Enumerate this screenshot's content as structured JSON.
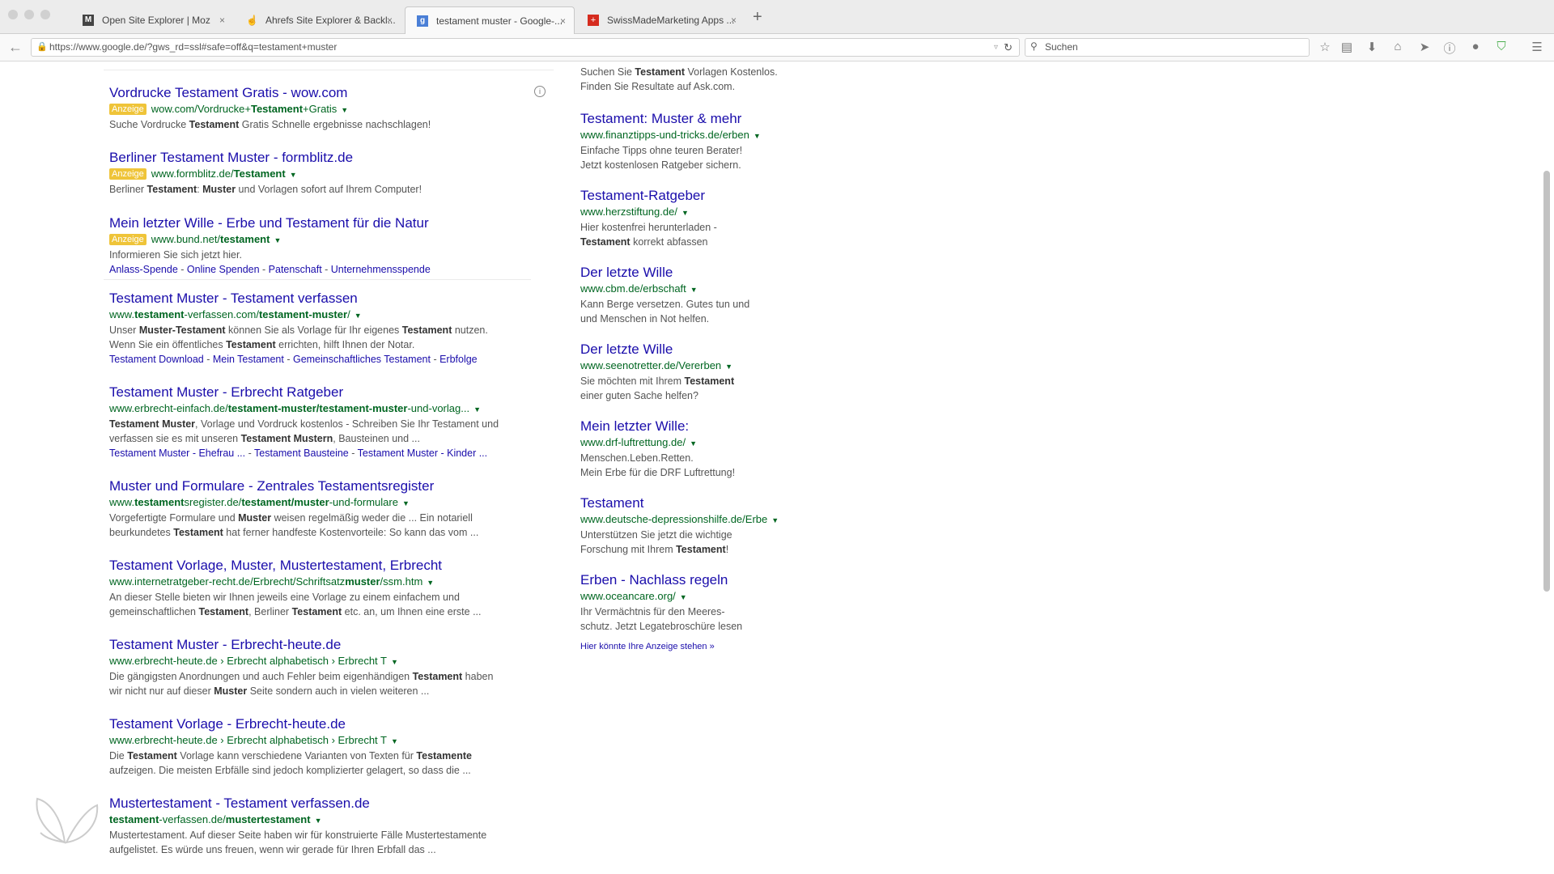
{
  "browser": {
    "tabs": [
      {
        "label": "Open Site Explorer | Moz",
        "icon": "moz-icon",
        "active": false
      },
      {
        "label": "Ahrefs Site Explorer & Backl...",
        "icon": "ahrefs-icon",
        "active": false
      },
      {
        "label": "testament muster - Google-...",
        "icon": "google-icon",
        "active": true
      },
      {
        "label": "SwissMadeMarketing Apps ...",
        "icon": "swiss-icon",
        "active": false
      }
    ],
    "new_tab": "+",
    "close": "×",
    "url": "https://www.google.de/?gws_rd=ssl#safe=off&q=testament+muster",
    "search_placeholder": "Suchen",
    "toolbar_icons": [
      "star-icon",
      "clipboard-icon",
      "download-icon",
      "home-icon",
      "send-icon",
      "info-icon",
      "chat-icon",
      "shield-icon",
      "menu-icon"
    ],
    "colors": {
      "accent": "#1a0dab",
      "url_green": "#006621",
      "ad_badge": "#efc439"
    }
  },
  "main": {
    "badge": "Anzeige",
    "ads": [
      {
        "title": "Vordrucke Testament Gratis - wow.com",
        "url_parts": [
          [
            "wow.com/Vordrucke+",
            false
          ],
          [
            "Testament",
            true
          ],
          [
            "+Gratis",
            false
          ]
        ],
        "snippet": [
          [
            "Suche Vordrucke ",
            false
          ],
          [
            "Testament",
            true
          ],
          [
            " Gratis Schnelle ergebnisse nachschlagen!",
            false
          ]
        ]
      },
      {
        "title": "Berliner Testament Muster - formblitz.de",
        "url_parts": [
          [
            "www.formblitz.de/",
            false
          ],
          [
            "Testament",
            true
          ]
        ],
        "snippet": [
          [
            "Berliner ",
            false
          ],
          [
            "Testament",
            true
          ],
          [
            ": ",
            false
          ],
          [
            "Muster",
            true
          ],
          [
            " und Vorlagen sofort auf Ihrem Computer!",
            false
          ]
        ]
      },
      {
        "title": "Mein letzter Wille - Erbe und Testament für die Natur",
        "url_parts": [
          [
            "www.bund.net/",
            false
          ],
          [
            "testament",
            true
          ]
        ],
        "snippet": [
          [
            "Informieren Sie sich jetzt hier.",
            false
          ]
        ],
        "sitelinks": [
          "Anlass-Spende",
          "Online Spenden",
          "Patenschaft",
          "Unternehmensspende"
        ]
      }
    ],
    "results": [
      {
        "title": "Testament Muster - Testament verfassen",
        "url_parts": [
          [
            "www.",
            false
          ],
          [
            "testament",
            true
          ],
          [
            "-verfassen.com/",
            false
          ],
          [
            "testament-muster",
            true
          ],
          [
            "/",
            false
          ]
        ],
        "lines": [
          [
            [
              "Unser ",
              false
            ],
            [
              "Muster-Testament",
              true
            ],
            [
              " können Sie als Vorlage für Ihr eigenes ",
              false
            ],
            [
              "Testament",
              true
            ],
            [
              " nutzen.",
              false
            ]
          ],
          [
            [
              "Wenn Sie ein öffentliches ",
              false
            ],
            [
              "Testament",
              true
            ],
            [
              " errichten, hilft Ihnen der Notar.",
              false
            ]
          ]
        ],
        "sitelinks": [
          "Testament Download",
          "Mein Testament",
          "Gemeinschaftliches Testament",
          "Erbfolge"
        ]
      },
      {
        "title": "Testament Muster - Erbrecht Ratgeber",
        "url_parts": [
          [
            "www.erbrecht-einfach.de/",
            false
          ],
          [
            "testament-muster/testament-muster",
            true
          ],
          [
            "-und-vorlag...",
            false
          ]
        ],
        "lines": [
          [
            [
              "Testament Muster",
              true
            ],
            [
              ", Vorlage und Vordruck kostenlos - Schreiben Sie Ihr Testament und",
              false
            ]
          ],
          [
            [
              "verfassen sie es mit unseren ",
              false
            ],
            [
              "Testament Mustern",
              true
            ],
            [
              ", Bausteinen und ...",
              false
            ]
          ]
        ],
        "sitelinks": [
          "Testament Muster - Ehefrau ...",
          "Testament Bausteine",
          "Testament Muster - Kinder ..."
        ]
      },
      {
        "title": "Muster und Formulare - Zentrales Testamentsregister",
        "url_parts": [
          [
            "www.",
            false
          ],
          [
            "testament",
            true
          ],
          [
            "sregister.de/",
            false
          ],
          [
            "testament/muster",
            true
          ],
          [
            "-und-formulare",
            false
          ]
        ],
        "lines": [
          [
            [
              "Vorgefertigte Formulare und ",
              false
            ],
            [
              "Muster",
              true
            ],
            [
              " weisen regelmäßig weder die ... Ein notariell",
              false
            ]
          ],
          [
            [
              "beurkundetes ",
              false
            ],
            [
              "Testament",
              true
            ],
            [
              " hat ferner handfeste Kostenvorteile: So kann das vom ...",
              false
            ]
          ]
        ]
      },
      {
        "title": "Testament Vorlage, Muster, Mustertestament, Erbrecht",
        "url_parts": [
          [
            "www.internetratgeber-recht.de/Erbrecht/Schriftsatz",
            false
          ],
          [
            "muster",
            true
          ],
          [
            "/ssm.htm",
            false
          ]
        ],
        "lines": [
          [
            [
              "An dieser Stelle bieten wir Ihnen jeweils eine Vorlage zu einem einfachem und",
              false
            ]
          ],
          [
            [
              "gemeinschaftlichen ",
              false
            ],
            [
              "Testament",
              true
            ],
            [
              ", Berliner ",
              false
            ],
            [
              "Testament",
              true
            ],
            [
              " etc. an, um Ihnen eine erste ...",
              false
            ]
          ]
        ]
      },
      {
        "title": "Testament Muster - Erbrecht-heute.de",
        "url_parts": [
          [
            "www.erbrecht-heute.de › Erbrecht alphabetisch › Erbrecht T",
            false
          ]
        ],
        "lines": [
          [
            [
              "Die gängigsten Anordnungen und auch Fehler beim eigenhändigen ",
              false
            ],
            [
              "Testament",
              true
            ],
            [
              " haben",
              false
            ]
          ],
          [
            [
              "wir nicht nur auf dieser ",
              false
            ],
            [
              "Muster",
              true
            ],
            [
              " Seite sondern auch in vielen weiteren ...",
              false
            ]
          ]
        ]
      },
      {
        "title": "Testament Vorlage - Erbrecht-heute.de",
        "url_parts": [
          [
            "www.erbrecht-heute.de › Erbrecht alphabetisch › Erbrecht T",
            false
          ]
        ],
        "lines": [
          [
            [
              "Die ",
              false
            ],
            [
              "Testament",
              true
            ],
            [
              " Vorlage kann verschiedene Varianten von Texten für ",
              false
            ],
            [
              "Testamente",
              true
            ]
          ],
          [
            [
              "aufzeigen. Die meisten Erbfälle sind jedoch komplizierter gelagert, so dass die ...",
              false
            ]
          ]
        ]
      },
      {
        "title": "Mustertestament - Testament verfassen.de",
        "url_parts": [
          [
            "testament",
            true
          ],
          [
            "-verfassen.de/",
            false
          ],
          [
            "mustertestament",
            true
          ]
        ],
        "lines": [
          [
            [
              "Mustertestament. Auf dieser Seite haben wir für konstruierte Fälle Mustertestamente",
              false
            ]
          ],
          [
            [
              "aufgelistet. Es würde uns freuen, wenn wir gerade für Ihren Erbfall das ...",
              false
            ]
          ]
        ]
      }
    ]
  },
  "side_ads": {
    "top_lines": [
      [
        [
          "Suchen Sie ",
          false
        ],
        [
          "Testament",
          true
        ],
        [
          " Vorlagen Kostenlos.",
          false
        ]
      ],
      [
        [
          "Finden Sie Resultate auf Ask.com.",
          false
        ]
      ]
    ],
    "items": [
      {
        "title": "Testament: Muster & mehr",
        "url": "www.finanztipps-und-tricks.de/erben",
        "lines": [
          [
            [
              "Einfache Tipps ohne teuren Berater!",
              false
            ]
          ],
          [
            [
              "Jetzt kostenlosen Ratgeber sichern.",
              false
            ]
          ]
        ]
      },
      {
        "title": "Testament-Ratgeber",
        "url": "www.herzstiftung.de/",
        "lines": [
          [
            [
              "Hier kostenfrei herunterladen -",
              false
            ]
          ],
          [
            [
              "Testament",
              true
            ],
            [
              " korrekt abfassen",
              false
            ]
          ]
        ]
      },
      {
        "title": "Der letzte Wille",
        "url": "www.cbm.de/erbschaft",
        "lines": [
          [
            [
              "Kann Berge versetzen. Gutes tun und",
              false
            ]
          ],
          [
            [
              "und Menschen in Not helfen.",
              false
            ]
          ]
        ]
      },
      {
        "title": "Der letzte Wille",
        "url": "www.seenotretter.de/Vererben",
        "lines": [
          [
            [
              "Sie möchten mit Ihrem ",
              false
            ],
            [
              "Testament",
              true
            ]
          ],
          [
            [
              "einer guten Sache helfen?",
              false
            ]
          ]
        ]
      },
      {
        "title": "Mein letzter Wille:",
        "url": "www.drf-luftrettung.de/",
        "lines": [
          [
            [
              "Menschen.Leben.Retten.",
              false
            ]
          ],
          [
            [
              "Mein Erbe für die DRF Luftrettung!",
              false
            ]
          ]
        ]
      },
      {
        "title": "Testament",
        "url": "www.deutsche-depressionshilfe.de/Erbe",
        "lines": [
          [
            [
              "Unterstützen Sie jetzt die wichtige",
              false
            ]
          ],
          [
            [
              "Forschung mit Ihrem ",
              false
            ],
            [
              "Testament",
              true
            ],
            [
              "!",
              false
            ]
          ]
        ]
      },
      {
        "title": "Erben - Nachlass regeln",
        "url": "www.oceancare.org/",
        "lines": [
          [
            [
              "Ihr Vermächtnis für den Meeres-",
              false
            ]
          ],
          [
            [
              "schutz. Jetzt Legatebroschüre lesen",
              false
            ]
          ]
        ]
      }
    ],
    "more_link": "Hier könnte Ihre Anzeige stehen »"
  }
}
